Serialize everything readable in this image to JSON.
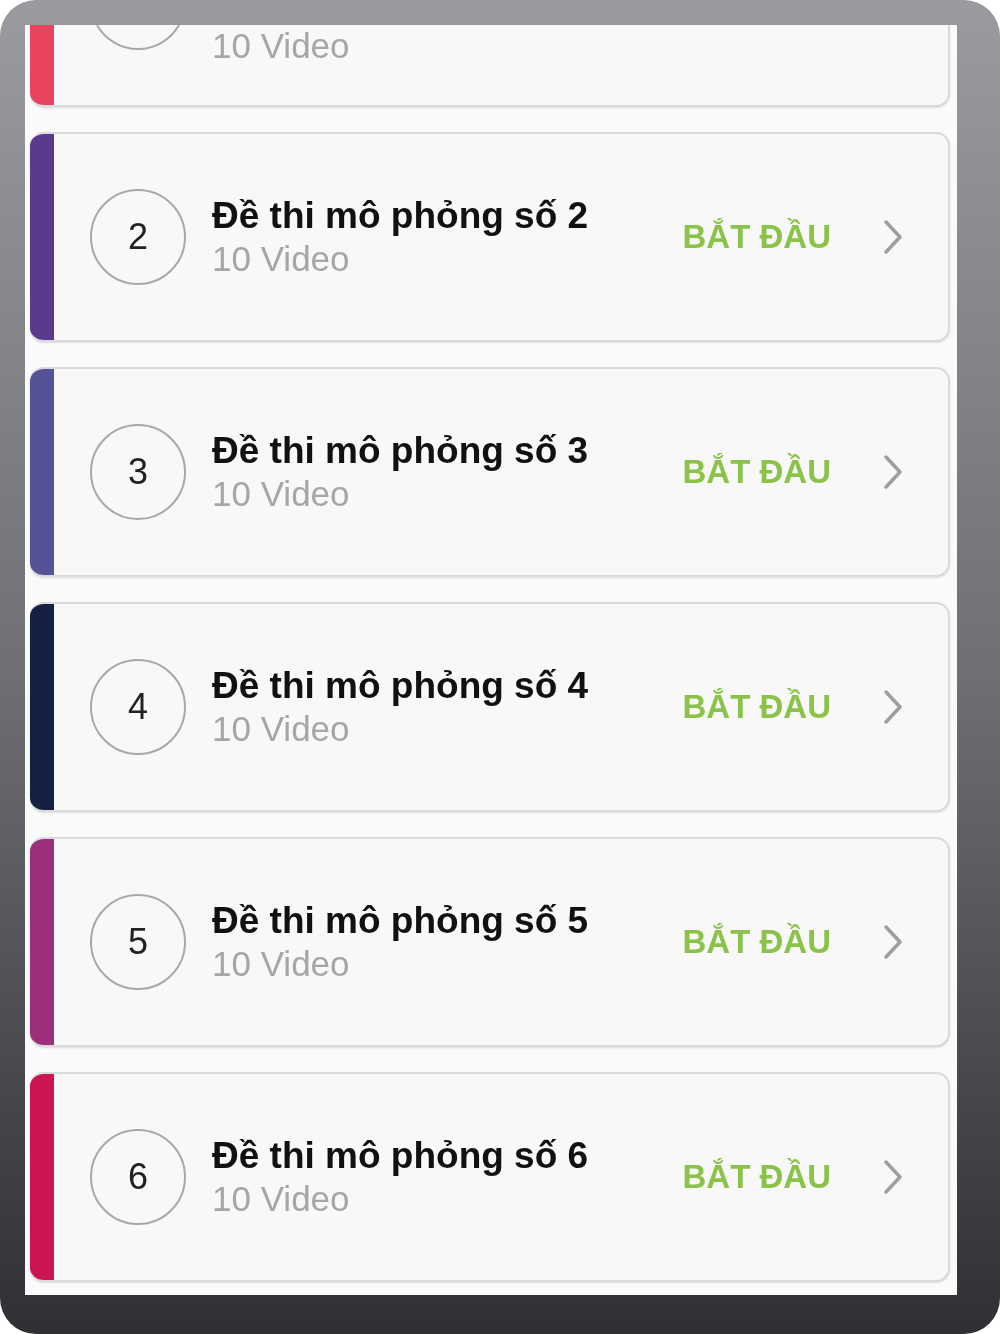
{
  "cards": [
    {
      "kind": "partial",
      "subtitle": "10 Video",
      "color": "#e8445f"
    },
    {
      "kind": "full",
      "number": "2",
      "title": "Đề thi mô phỏng số 2",
      "subtitle": "10 Video",
      "action": "BẮT ĐẦU",
      "color": "#5a3a8c"
    },
    {
      "kind": "full",
      "number": "3",
      "title": "Đề thi mô phỏng số 3",
      "subtitle": "10 Video",
      "action": "BẮT ĐẦU",
      "color": "#55529a"
    },
    {
      "kind": "full",
      "number": "4",
      "title": "Đề thi mô phỏng số 4",
      "subtitle": "10 Video",
      "action": "BẮT ĐẦU",
      "color": "#142142"
    },
    {
      "kind": "full",
      "number": "5",
      "title": "Đề thi mô phỏng số 5",
      "subtitle": "10 Video",
      "action": "BẮT ĐẦU",
      "color": "#9b2f7c"
    },
    {
      "kind": "full",
      "number": "6",
      "title": "Đề thi mô phỏng số 6",
      "subtitle": "10 Video",
      "action": "BẮT ĐẦU",
      "color": "#cc1452"
    }
  ]
}
